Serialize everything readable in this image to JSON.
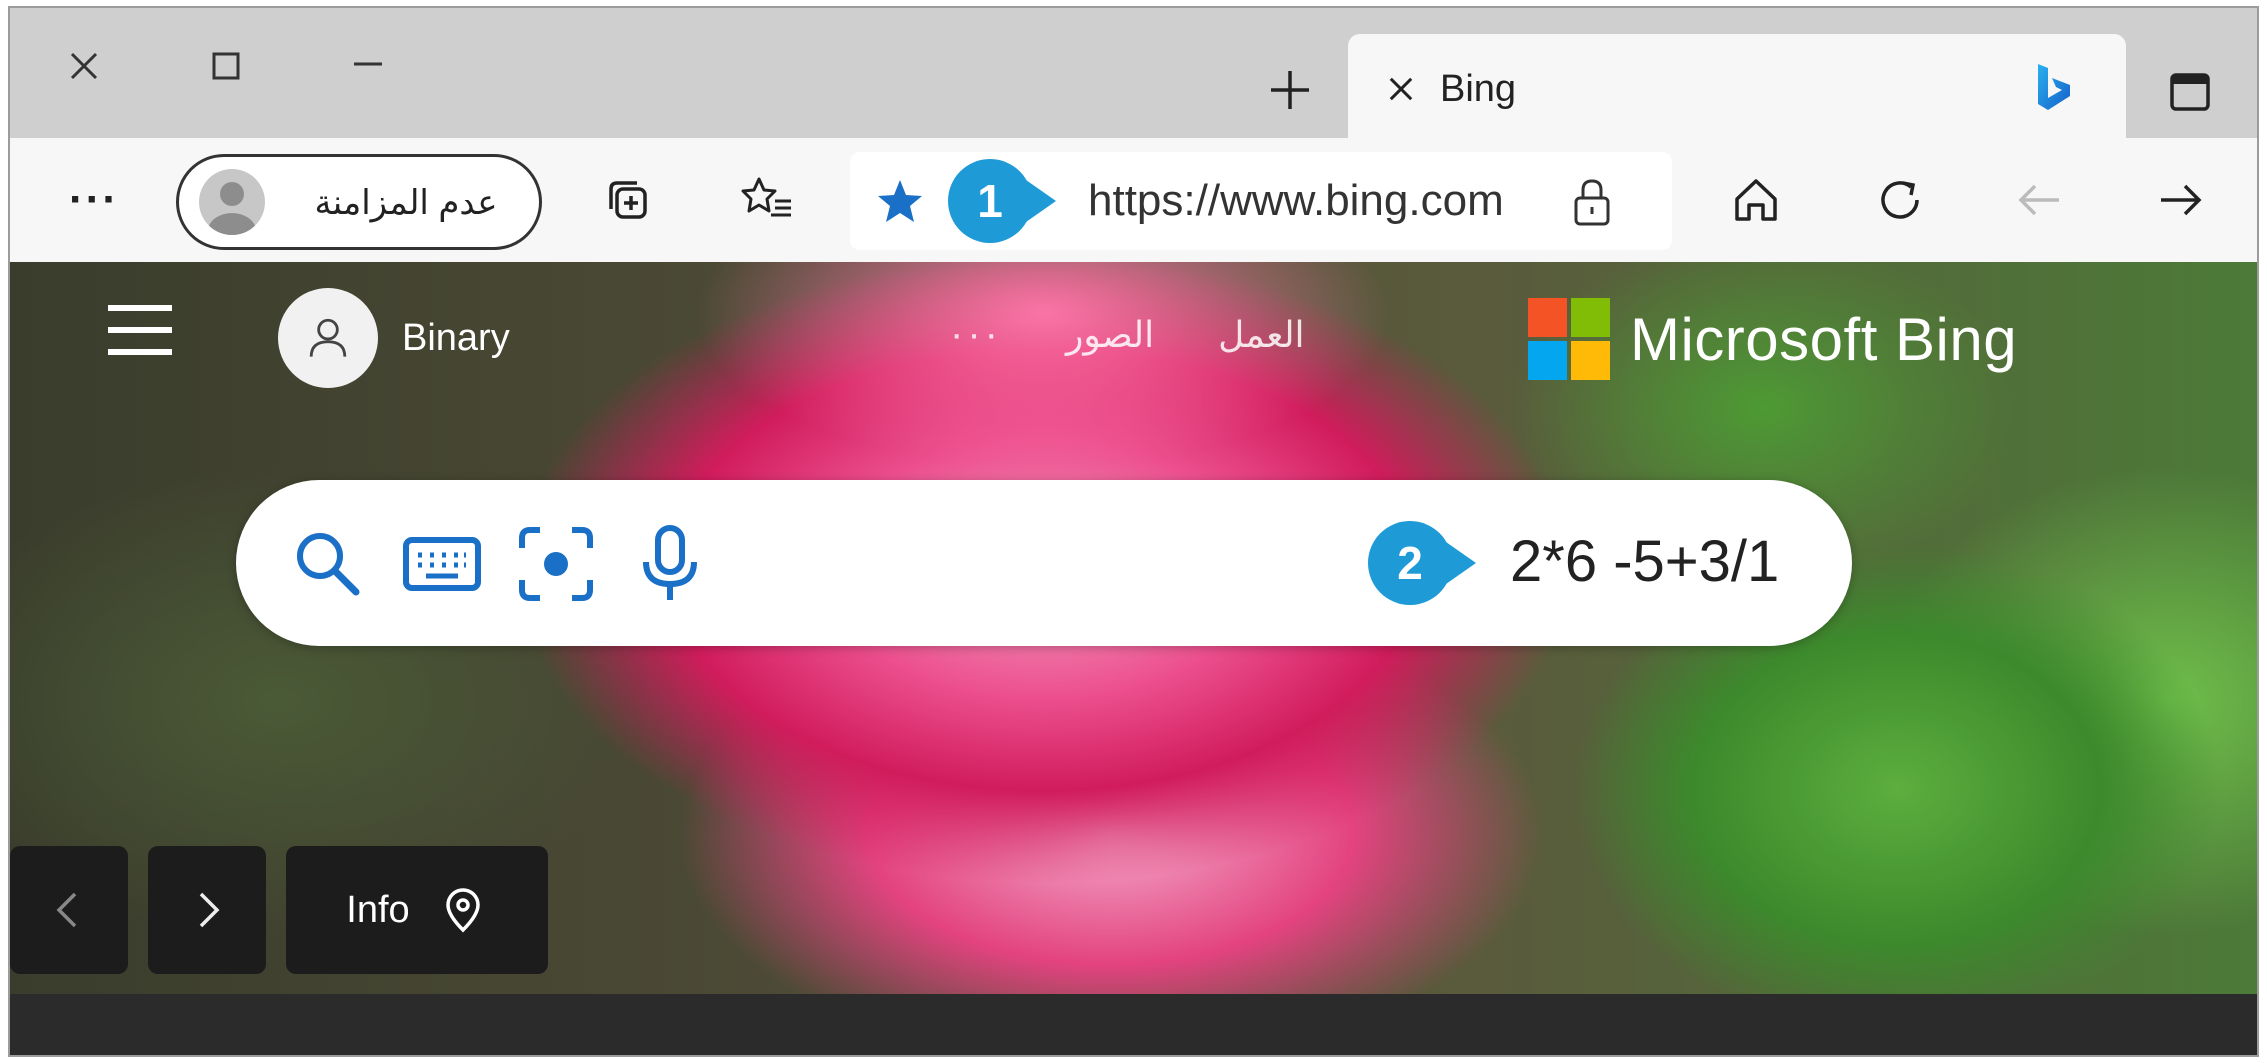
{
  "window": {
    "controls": [
      "close-icon",
      "maximize-icon",
      "minimize-icon"
    ]
  },
  "tab": {
    "title": "Bing",
    "favicon": "bing-logo-icon"
  },
  "toolbar": {
    "more_label": "···",
    "profile_label": "عدم المزامنة",
    "url": "https://www.bing.com",
    "badge_url": "1"
  },
  "bing": {
    "user_name": "Binary",
    "nav_links": [
      "الصور",
      "العمل"
    ],
    "nav_more": "···",
    "brand": "Microsoft Bing",
    "logo_colors": [
      "#f35325",
      "#81bc06",
      "#05a6f0",
      "#ffba08"
    ]
  },
  "search": {
    "query": "2*6 -5+3/1",
    "badge": "2"
  },
  "carousel": {
    "info_label": "Info"
  },
  "colors": {
    "accent_blue": "#1e9bd7",
    "icon_blue": "#1a6fc7"
  }
}
